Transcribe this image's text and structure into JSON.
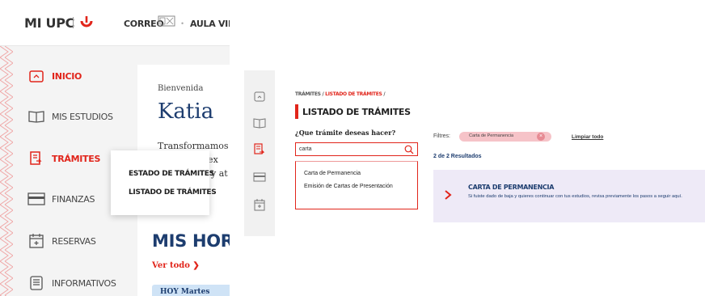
{
  "left_panel": {
    "topbar": {
      "logo_text": "MI UPC",
      "nav_correo": "CORREO",
      "nav_aula": "AULA VIRT"
    },
    "sidebar": {
      "items": [
        {
          "label": "INICIO",
          "icon": "home-icon",
          "active": true
        },
        {
          "label": "MIS ESTUDIOS",
          "icon": "book-icon",
          "active": false
        },
        {
          "label": "TRÁMITES",
          "icon": "document-icon",
          "active": true
        },
        {
          "label": "FINANZAS",
          "icon": "card-icon",
          "active": false
        },
        {
          "label": "RESERVAS",
          "icon": "calendar-icon",
          "active": false
        },
        {
          "label": "INFORMATIVOS",
          "icon": "newspaper-icon",
          "active": false
        }
      ]
    },
    "dropdown": {
      "items": [
        "ESTADO DE TRÁMITES",
        "LISTADO DE TRÁMITES"
      ]
    },
    "content": {
      "greeting": "Bienvenida",
      "user_name": "Katia",
      "text_line1": "Transformamos",
      "text_line2": "a ex",
      "text_line3": "y at",
      "section_title": "MIS HORAR",
      "see_all": "Ver todo",
      "today_label": "HOY Martes"
    }
  },
  "right_panel": {
    "breadcrumb": {
      "parent": "TRÁMITES",
      "separator": " / ",
      "current": "LISTADO DE TRÁMITES",
      "trailing": " /"
    },
    "page_title": "LISTADO DE TRÁMITES",
    "question": "¿Que trámite deseas hacer?",
    "search": {
      "value": "carta"
    },
    "suggestions": [
      "Carta de Permanencia",
      "Emisión de Cartas de Presentación"
    ],
    "filters": {
      "label": "Filtres:",
      "chip": "Carta de Permanencia",
      "clear": "Limpiar todo"
    },
    "results": "2 de 2 Resultados",
    "card": {
      "title": "CARTA DE PERMANENCIA",
      "description": "Si fuiste dado de baja y quieres continuar con tus estudios, revisa previamente los pasos a seguir aquí."
    }
  },
  "colors": {
    "accent": "#e1251b",
    "navy": "#1d3d6f",
    "card_bg": "#eeeaf7",
    "chip_bg": "#f6c3c8"
  }
}
